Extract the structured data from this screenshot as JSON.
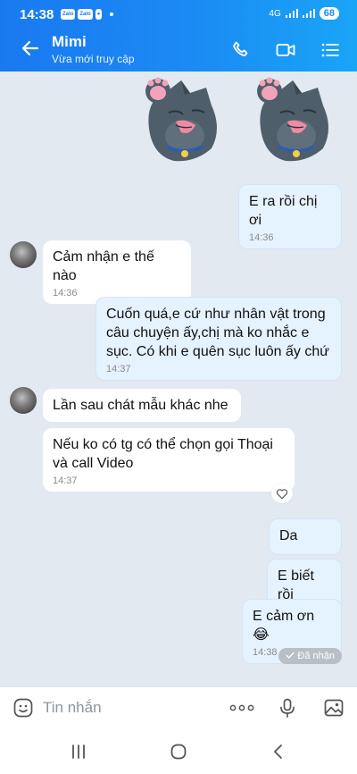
{
  "status": {
    "time": "14:38",
    "battery": "68",
    "network": "4G"
  },
  "header": {
    "title": "Mimi",
    "subtitle": "Vừa mới truy cập"
  },
  "messages": [
    {
      "side": "out",
      "text": "E ra rồi chị ơi",
      "time": "14:36"
    },
    {
      "side": "in",
      "text": "Cảm nhận e thế nào",
      "time": "14:36"
    },
    {
      "side": "out",
      "text": "Cuốn quá,e cứ như nhân vật trong câu chuyện ấy,chị mà ko nhắc e sục. Có khi e quên sục luôn ấy chứ",
      "time": "14:37"
    },
    {
      "side": "in",
      "text": "Lần sau chát mẫu khác nhe",
      "time": ""
    },
    {
      "side": "in",
      "text": "Nếu ko có tg có thể chọn gọi Thoại và call Video",
      "time": "14:37"
    },
    {
      "side": "out",
      "text": "Da",
      "time": ""
    },
    {
      "side": "out",
      "text": "E biết rồi",
      "time": ""
    },
    {
      "side": "out",
      "text": "E cảm ơn 😂",
      "time": "14:38"
    }
  ],
  "delivered_label": "Đã nhận",
  "input": {
    "placeholder": "Tin nhắn"
  },
  "colors": {
    "header_gradient_start": "#1a79f0",
    "header_gradient_end": "#19a5f6",
    "chat_bg": "#e2e9f1",
    "out_bubble": "#e5f2ff",
    "in_bubble": "#ffffff"
  },
  "icons": [
    "back-arrow-icon",
    "phone-icon",
    "video-call-icon",
    "menu-list-icon",
    "sticker-icon",
    "more-dots-icon",
    "microphone-icon",
    "image-icon",
    "heart-icon",
    "check-icon",
    "nav-recents-icon",
    "nav-home-icon",
    "nav-back-icon"
  ]
}
